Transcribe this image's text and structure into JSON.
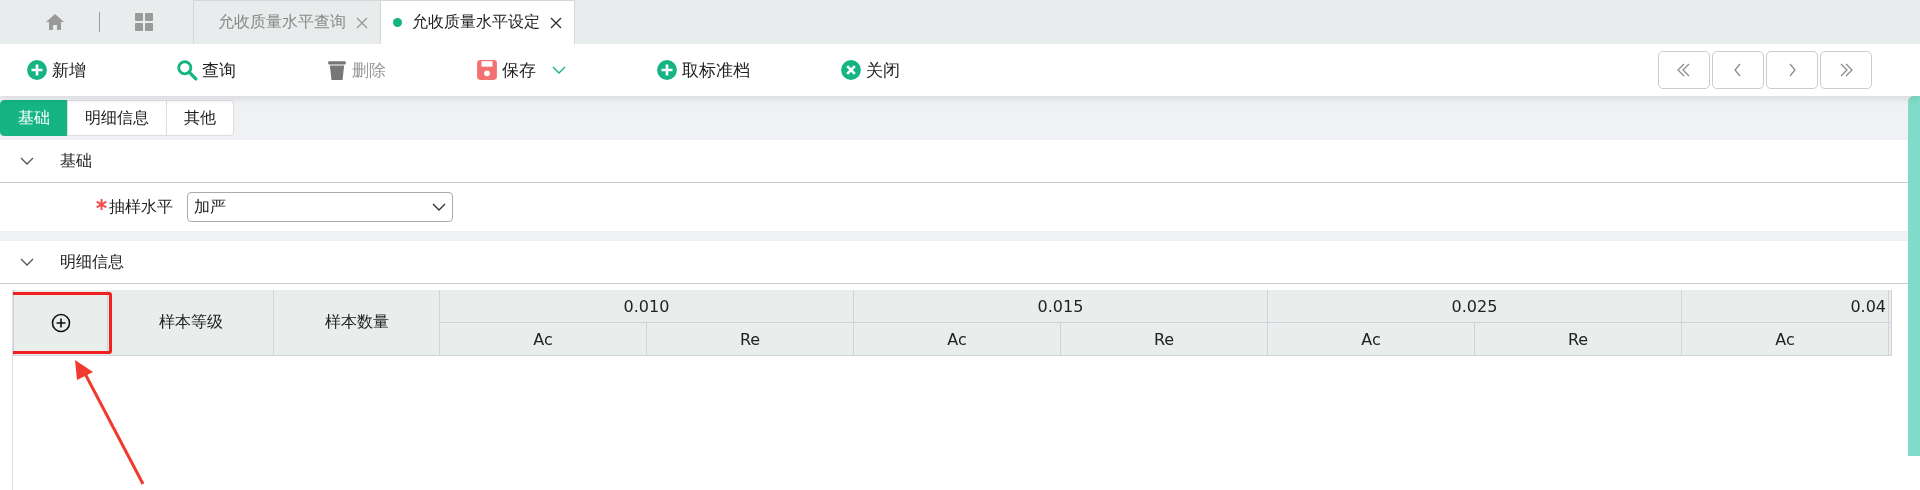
{
  "nav_tabs": [
    {
      "label": "允收质量水平查询",
      "kind": "page",
      "selected": false
    },
    {
      "label": "允收质量水平设定",
      "kind": "page",
      "selected": true
    }
  ],
  "toolbar": [
    {
      "label": "新增",
      "kind": "add",
      "disabled": false
    },
    {
      "label": "查询",
      "kind": "search",
      "disabled": false
    },
    {
      "label": "删除",
      "kind": "delete",
      "disabled": true
    },
    {
      "label": "保存",
      "kind": "save",
      "disabled": false,
      "dropdown": true
    },
    {
      "label": "取标准档",
      "kind": "add",
      "disabled": false
    },
    {
      "label": "关闭",
      "kind": "close",
      "disabled": false
    }
  ],
  "sub_tabs": [
    {
      "label": "基础",
      "selected": true
    },
    {
      "label": "明细信息",
      "selected": false
    },
    {
      "label": "其他",
      "selected": false
    }
  ],
  "basic_section": {
    "title": "基础",
    "expanded": true,
    "field": {
      "label": "抽样水平",
      "required": true,
      "value": "加严"
    }
  },
  "detail_section": {
    "title": "明细信息",
    "expanded": true,
    "table": {
      "columns": [
        "样本等级",
        "样本数量"
      ],
      "groups": [
        {
          "label": "0.010",
          "columns": [
            "Ac",
            "Re"
          ]
        },
        {
          "label": "0.015",
          "columns": [
            "Ac",
            "Re"
          ]
        },
        {
          "label": "0.025",
          "columns": [
            "Ac",
            "Re"
          ]
        },
        {
          "label": "0.04",
          "columns": [
            "Ac"
          ]
        }
      ]
    }
  }
}
